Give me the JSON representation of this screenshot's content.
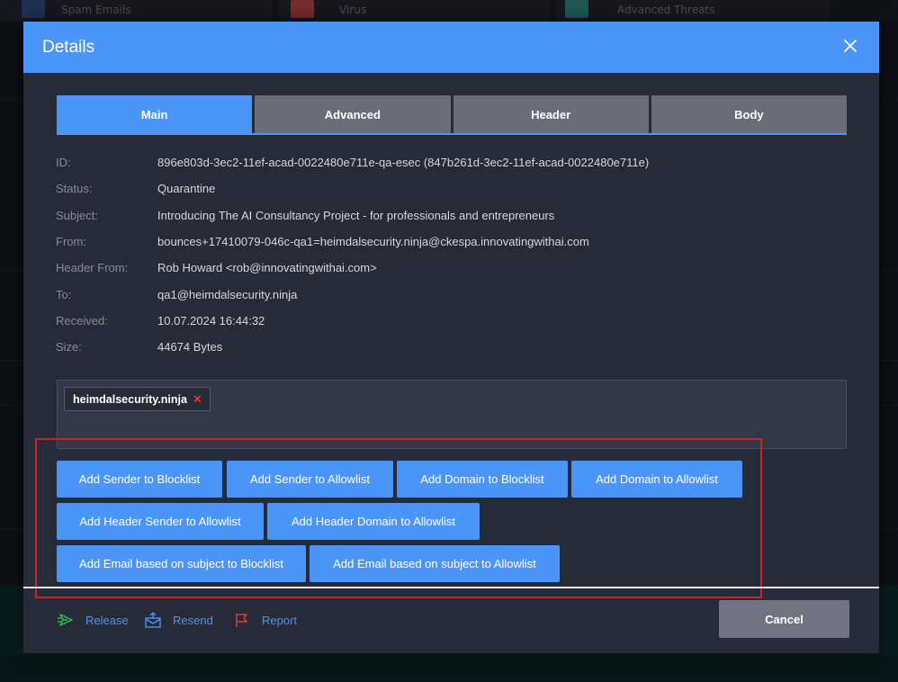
{
  "background": {
    "tiles": [
      {
        "label": "Spam Emails",
        "color": "#3a5a9a"
      },
      {
        "label": "Virus",
        "color": "#d9534f"
      },
      {
        "label": "Advanced Threats",
        "color": "#3aa39a"
      }
    ]
  },
  "modal": {
    "title": "Details",
    "close_icon": "close-icon"
  },
  "tabs": [
    {
      "label": "Main",
      "active": true
    },
    {
      "label": "Advanced",
      "active": false
    },
    {
      "label": "Header",
      "active": false
    },
    {
      "label": "Body",
      "active": false
    }
  ],
  "details": [
    {
      "label": "ID:",
      "value": "896e803d-3ec2-11ef-acad-0022480e711e-qa-esec (847b261d-3ec2-11ef-acad-0022480e711e)"
    },
    {
      "label": "Status:",
      "value": "Quarantine"
    },
    {
      "label": "Subject:",
      "value": "Introducing The AI Consultancy Project - for professionals and entrepreneurs"
    },
    {
      "label": "From:",
      "value": "bounces+17410079-046c-qa1=heimdalsecurity.ninja@ckespa.innovatingwithai.com"
    },
    {
      "label": "Header From:",
      "value": "Rob Howard <rob@innovatingwithai.com>"
    },
    {
      "label": "To:",
      "value": "qa1@heimdalsecurity.ninja"
    },
    {
      "label": "Received:",
      "value": "10.07.2024 16:44:32"
    },
    {
      "label": "Size:",
      "value": "44674 Bytes"
    }
  ],
  "tags": [
    {
      "label": "heimdalsecurity.ninja",
      "remove": "✕"
    }
  ],
  "actions": {
    "add_sender_blocklist": "Add Sender to Blocklist",
    "add_sender_allowlist": "Add Sender to Allowlist",
    "add_domain_blocklist": "Add Domain to Blocklist",
    "add_domain_allowlist": "Add Domain to Allowlist",
    "add_header_sender_allowlist": "Add Header Sender to Allowlist",
    "add_header_domain_allowlist": "Add Header Domain to Allowlist",
    "add_email_subject_blocklist": "Add Email based on subject to Blocklist",
    "add_email_subject_allowlist": "Add Email based on subject to Allowlist"
  },
  "footer": {
    "release": "Release",
    "resend": "Resend",
    "report": "Report",
    "cancel": "Cancel"
  },
  "colors": {
    "accent": "#4b94f8",
    "release": "#2ec05b",
    "resend": "#4b94f8",
    "report": "#e23b3b",
    "highlight": "#c4262d"
  }
}
